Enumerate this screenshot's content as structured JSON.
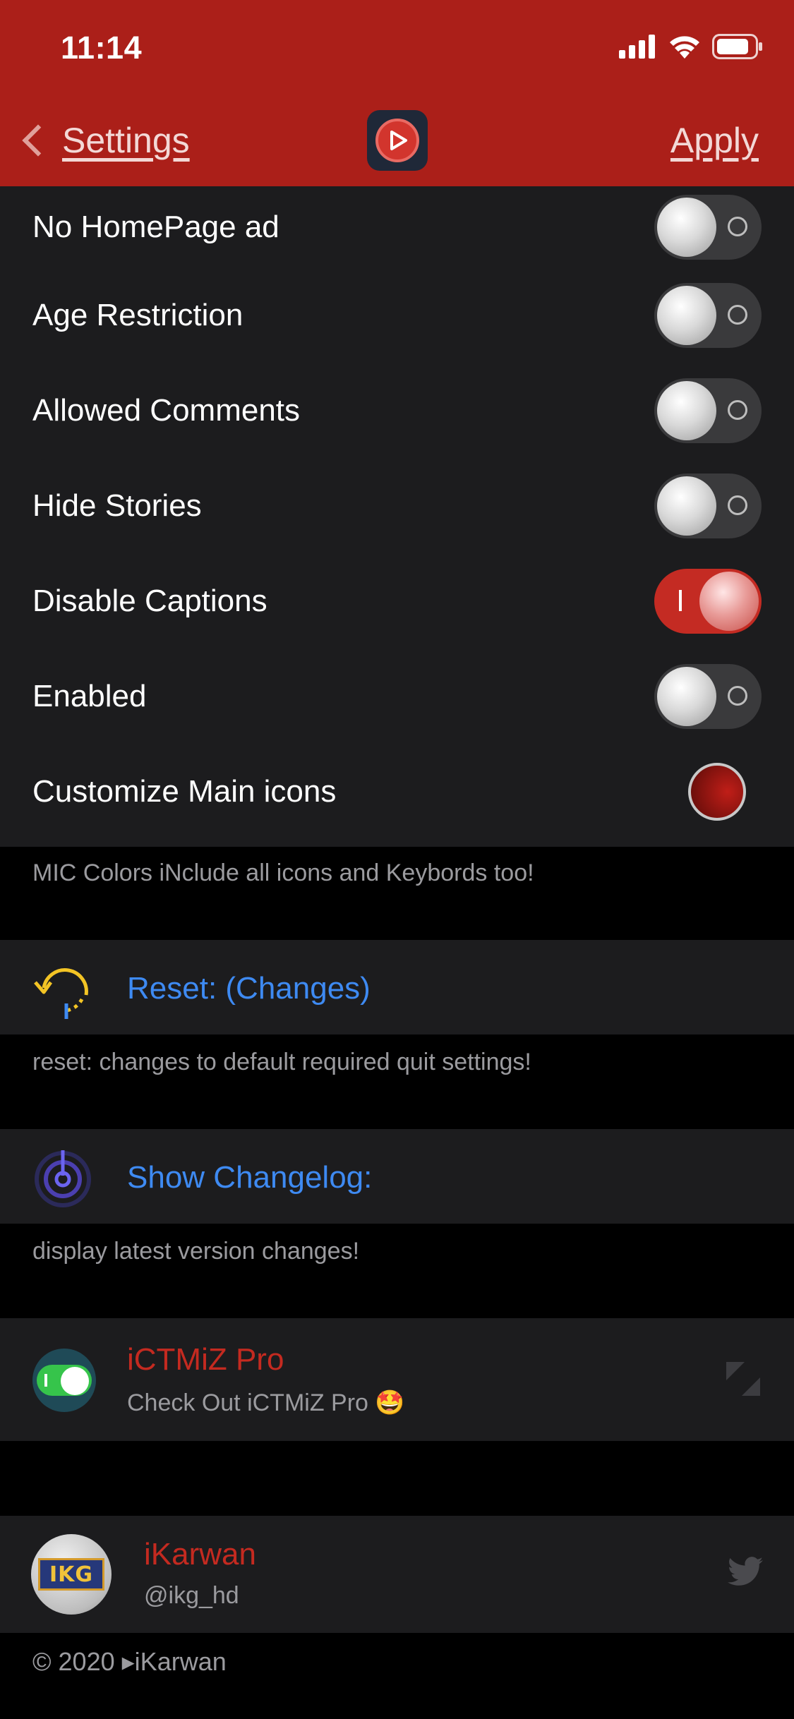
{
  "status_bar": {
    "time": "11:14"
  },
  "nav": {
    "back_label": "Settings",
    "apply_label": "Apply"
  },
  "toggles": [
    {
      "label": "No HomePage ad",
      "on": false
    },
    {
      "label": "Age Restriction",
      "on": false
    },
    {
      "label": "Allowed Comments",
      "on": false
    },
    {
      "label": "Hide Stories",
      "on": false
    },
    {
      "label": "Disable Captions",
      "on": true
    },
    {
      "label": "Enabled",
      "on": false
    }
  ],
  "customize": {
    "label": "Customize Main icons",
    "color": "#8b1410"
  },
  "customize_footer": "MIC Colors iNclude all icons and Keybords too!",
  "reset": {
    "title": "Reset: (Changes)",
    "footer": "reset: changes to default required quit settings!"
  },
  "changelog": {
    "title": "Show Changelog:",
    "footer": "display latest version changes!"
  },
  "promo": {
    "title": "iCTMiZ Pro",
    "subtitle": "Check Out iCTMiZ Pro 🤩"
  },
  "author": {
    "name": "iKarwan",
    "handle": "@ikg_hd",
    "avatar_text": "IKG"
  },
  "copyright": "© 2020 ▸iKarwan",
  "colors": {
    "header": "#ab1f19",
    "accent_blue": "#3e8af2",
    "accent_red": "#c42a20"
  }
}
